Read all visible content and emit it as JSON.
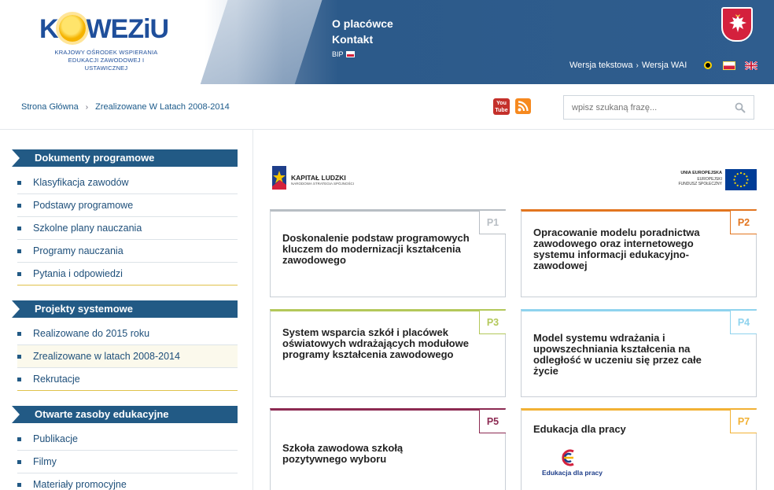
{
  "header": {
    "logo_text": "KOWEZiU",
    "logo_subtitle_1": "KRAJOWY OŚRODEK WSPIERANIA",
    "logo_subtitle_2": "EDUKACJI ZAWODOWEJ I USTAWICZNEJ",
    "nav": [
      "O placówce",
      "Kontakt"
    ],
    "bip": "BIP",
    "text_version": "Wersja tekstowa",
    "separator": "›",
    "wai_version": "Wersja WAI"
  },
  "breadcrumb": {
    "items": [
      "Strona Główna",
      "Zrealizowane W Latach 2008-2014"
    ],
    "separator": "›"
  },
  "social": {
    "youtube_line1": "You",
    "youtube_line2": "Tube"
  },
  "search": {
    "placeholder": "wpisz szukaną frazę..."
  },
  "sidebar": {
    "sections": [
      {
        "title": "Dokumenty programowe",
        "items": [
          "Klasyfikacja zawodów",
          "Podstawy programowe",
          "Szkolne plany nauczania",
          "Programy nauczania",
          "Pytania i odpowiedzi"
        ]
      },
      {
        "title": "Projekty systemowe",
        "items": [
          "Realizowane do 2015 roku",
          "Zrealizowane w latach 2008-2014",
          "Rekrutacje"
        ]
      },
      {
        "title": "Otwarte zasoby edukacyjne",
        "items": [
          "Publikacje",
          "Filmy",
          "Materiały promocyjne"
        ]
      }
    ],
    "active_item": "Zrealizowane w latach 2008-2014"
  },
  "eu_logos": {
    "kapital_title": "KAPITAŁ LUDZKI",
    "kapital_subtitle": "NARODOWA STRATEGIA SPÓJNOŚCI",
    "ue_line1": "UNIA EUROPEJSKA",
    "ue_line2": "EUROPEJSKI",
    "ue_line3": "FUNDUSZ SPOŁECZNY"
  },
  "cards": [
    {
      "tag": "P1",
      "title": "Doskonalenie podstaw programowych kluczem do modernizacji kształcenia zawodowego",
      "color": "#b8bec4"
    },
    {
      "tag": "P2",
      "title": "Opracowanie modelu poradnictwa zawodowego oraz internetowego systemu informacji edukacyjno-zawodowej",
      "color": "#e2751f"
    },
    {
      "tag": "P3",
      "title": "System wsparcia szkół i placówek oświatowych wdrażających modułowe programy kształcenia zawodowego",
      "color": "#b3c85a"
    },
    {
      "tag": "P4",
      "title": "Model systemu wdrażania i upowszechniania kształcenia na odległość w uczeniu się przez całe życie",
      "color": "#8fd3ee"
    },
    {
      "tag": "P5",
      "title": "Szkoła zawodowa szkołą pozytywnego wyboru",
      "color": "#8c2a52"
    },
    {
      "tag": "P7",
      "title": "Edukacja dla pracy",
      "color": "#f2b134",
      "logo_caption": "Edukacja dla pracy"
    }
  ],
  "colors": {
    "header_blue": "#2f5d8e",
    "sidebar_blue": "#225a85",
    "link_blue": "#1b5a8a"
  }
}
